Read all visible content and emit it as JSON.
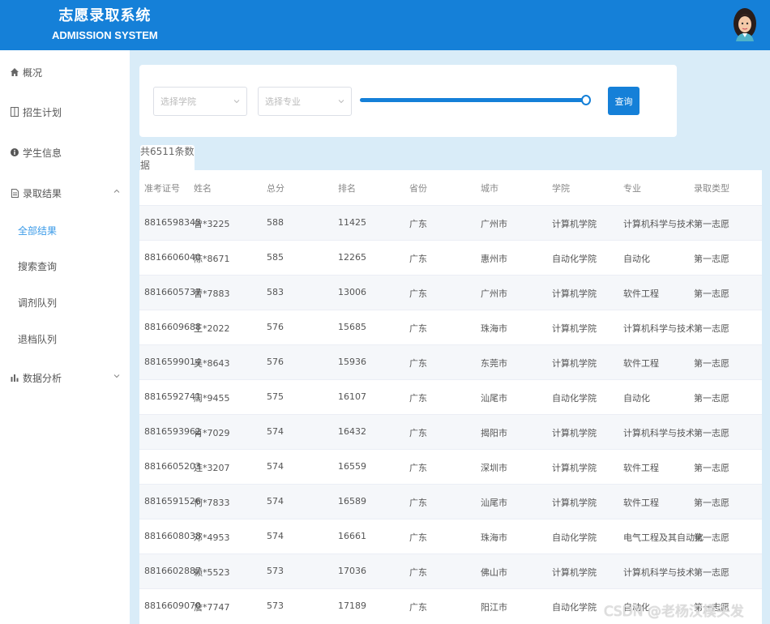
{
  "header": {
    "title_cn": "志愿录取系统",
    "title_en": "ADMISSION SYSTEM"
  },
  "sidebar": {
    "items": [
      {
        "label": "概况",
        "icon": "home-icon"
      },
      {
        "label": "招生计划",
        "icon": "book-icon"
      },
      {
        "label": "学生信息",
        "icon": "info-icon"
      },
      {
        "label": "录取结果",
        "icon": "document-icon"
      },
      {
        "label": "数据分析",
        "icon": "bar-chart-icon"
      }
    ],
    "subitems": [
      {
        "label": "全部结果",
        "active": true
      },
      {
        "label": "搜索查询",
        "active": false
      },
      {
        "label": "调剂队列",
        "active": false
      },
      {
        "label": "退档队列",
        "active": false
      }
    ]
  },
  "filters": {
    "college_placeholder": "选择学院",
    "major_placeholder": "选择专业",
    "slider_value": 1.0,
    "query_label": "查询"
  },
  "count_label": "共6511条数据",
  "table": {
    "columns": [
      "准考证号",
      "姓名",
      "总分",
      "排名",
      "省份",
      "城市",
      "学院",
      "专业",
      "录取类型"
    ],
    "rows": [
      [
        "8816598345",
        "曾*3225",
        "588",
        "11425",
        "广东",
        "广州市",
        "计算机学院",
        "计算机科学与技术",
        "第一志愿"
      ],
      [
        "8816606040",
        "陈*8671",
        "585",
        "12265",
        "广东",
        "惠州市",
        "自动化学院",
        "自动化",
        "第一志愿"
      ],
      [
        "8816605737",
        "曹*7883",
        "583",
        "13006",
        "广东",
        "广州市",
        "计算机学院",
        "软件工程",
        "第一志愿"
      ],
      [
        "8816609688",
        "王*2022",
        "576",
        "15685",
        "广东",
        "珠海市",
        "计算机学院",
        "计算机科学与技术",
        "第一志愿"
      ],
      [
        "8816599014",
        "吴*8643",
        "576",
        "15936",
        "广东",
        "东莞市",
        "计算机学院",
        "软件工程",
        "第一志愿"
      ],
      [
        "8816592741",
        "周*9455",
        "575",
        "16107",
        "广东",
        "汕尾市",
        "自动化学院",
        "自动化",
        "第一志愿"
      ],
      [
        "8816593962",
        "肖*7029",
        "574",
        "16432",
        "广东",
        "揭阳市",
        "计算机学院",
        "计算机科学与技术",
        "第一志愿"
      ],
      [
        "8816605203",
        "连*3207",
        "574",
        "16559",
        "广东",
        "深圳市",
        "计算机学院",
        "软件工程",
        "第一志愿"
      ],
      [
        "8816591526",
        "何*7833",
        "574",
        "16589",
        "广东",
        "汕尾市",
        "计算机学院",
        "软件工程",
        "第一志愿"
      ],
      [
        "8816608038",
        "邓*4953",
        "574",
        "16661",
        "广东",
        "珠海市",
        "自动化学院",
        "电气工程及其自动化",
        "第一志愿"
      ],
      [
        "8816602887",
        "赖*5523",
        "573",
        "17036",
        "广东",
        "佛山市",
        "计算机学院",
        "计算机科学与技术",
        "第一志愿"
      ],
      [
        "8816609070",
        "詹*7747",
        "573",
        "17189",
        "广东",
        "阳江市",
        "自动化学院",
        "自动化",
        "第一志愿"
      ]
    ]
  },
  "watermark": "CSDN @老杨汉模头发",
  "colors": {
    "primary": "#1580d8",
    "background": "#d9ecf8",
    "active_link": "#3b9be8"
  }
}
